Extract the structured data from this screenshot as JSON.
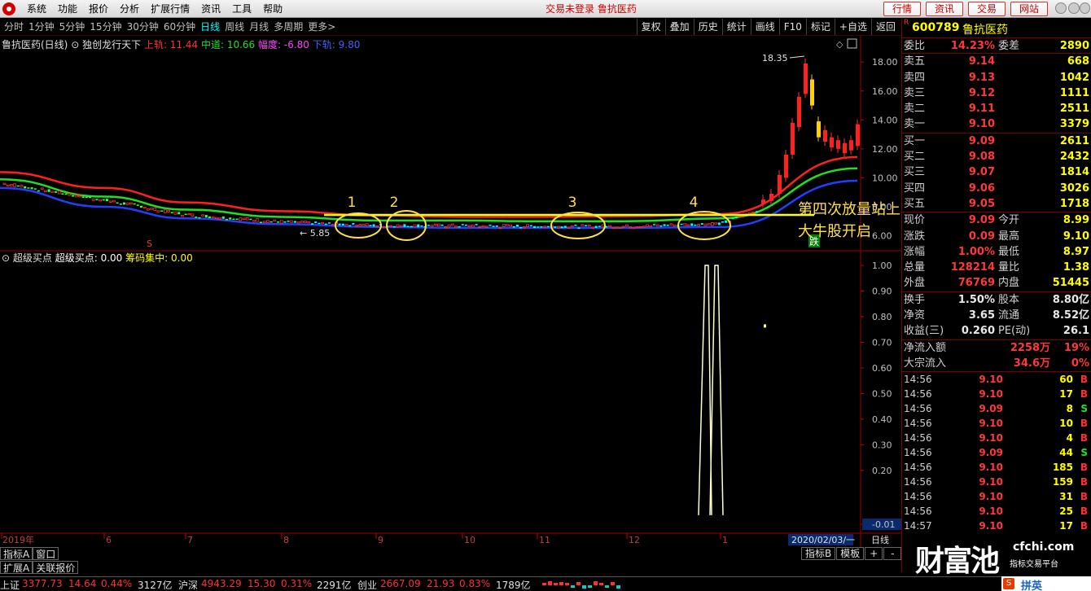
{
  "menu": {
    "items": [
      "系统",
      "功能",
      "报价",
      "分析",
      "扩展行情",
      "资讯",
      "工具",
      "帮助"
    ],
    "center_text": "交易未登录 鲁抗医药",
    "buttons": [
      "行情",
      "资讯",
      "交易",
      "网站"
    ]
  },
  "periods": {
    "items": [
      "分时",
      "1分钟",
      "5分钟",
      "15分钟",
      "30分钟",
      "60分钟",
      "日线",
      "周线",
      "月线",
      "多周期",
      "更多>"
    ],
    "active_index": 6,
    "right_items": [
      "复权",
      "叠加",
      "历史",
      "统计",
      "画线",
      "F10",
      "标记",
      "+自选",
      "返回"
    ]
  },
  "chart_header": {
    "stock": "鲁抗医药(日线)",
    "indicator": "独创龙行天下",
    "upper_label": "上轨: 11.44",
    "mid_label": "中道: 10.66",
    "range_label": "幅度: -6.80",
    "lower_label": "下轨: 9.80"
  },
  "sub_header": {
    "name": "超级买点",
    "value_label": "超级买点: 0.00",
    "chip_label": "筹码集中: 0.00"
  },
  "annotations": {
    "marks": [
      "1",
      "2",
      "3",
      "4"
    ],
    "text_line1": "第四次放量站上五线",
    "text_line2": "大牛股开启",
    "high_label": "18.35",
    "low_label": "5.85",
    "s_label": "S",
    "die_label": "跌"
  },
  "colors": {
    "up": "#ff3030",
    "down": "#00ffff",
    "upper_band": "#ff2020",
    "mid_band": "#20e020",
    "lower_band": "#2040ff",
    "annotation": "#ffe04a"
  },
  "chart_data": [
    {
      "type": "line",
      "title": "",
      "x": [
        "2019年",
        "6",
        "7",
        "8",
        "9",
        "10",
        "11",
        "12",
        "1",
        "2020/02/03/一"
      ],
      "series": [
        {
          "name": "上轨",
          "values": [
            10.4,
            9.3,
            8.3,
            7.7,
            7.4,
            7.3,
            7.3,
            7.35,
            7.5,
            11.44
          ]
        },
        {
          "name": "中道",
          "values": [
            9.9,
            8.7,
            7.8,
            7.3,
            7.05,
            7.05,
            7.0,
            7.0,
            7.2,
            10.66
          ]
        },
        {
          "name": "下轨",
          "values": [
            9.3,
            8.0,
            7.2,
            6.8,
            6.6,
            6.55,
            6.55,
            6.55,
            6.6,
            9.8
          ]
        }
      ],
      "yticks": [
        "18.00",
        "16.00",
        "14.00",
        "12.00",
        "10.00",
        "8.00",
        "6.00"
      ],
      "ylim": [
        5.3,
        18.8
      ],
      "annotations": [
        "18.35",
        "5.85"
      ]
    },
    {
      "type": "line",
      "title": "",
      "series": [
        {
          "name": "超级买点",
          "values": [
            0,
            0,
            0,
            0,
            0,
            0,
            0,
            0,
            1,
            0
          ]
        }
      ],
      "yticks": [
        "1.00",
        "0.90",
        "0.80",
        "0.70",
        "0.60",
        "0.50",
        "0.40",
        "0.30",
        "0.20",
        "-0.01"
      ],
      "ylim": [
        -0.01,
        1.0
      ]
    }
  ],
  "axis": {
    "y1": [
      "18.00",
      "16.00",
      "14.00",
      "12.00",
      "10.00",
      "8.00",
      "6.00"
    ],
    "y2": [
      "1.00",
      "0.90",
      "0.80",
      "0.70",
      "0.60",
      "0.50",
      "0.40",
      "0.30",
      "0.20",
      "-0.01"
    ],
    "x": [
      "2019年",
      "6",
      "7",
      "8",
      "9",
      "10",
      "11",
      "12",
      "1"
    ],
    "date_badge": "2020/02/03/一",
    "right_label": "日线"
  },
  "quote": {
    "code": "600789",
    "name": "鲁抗医药",
    "r_mark": "R",
    "weibi_label": "委比",
    "weibi": "14.23%",
    "weicha_label": "委差",
    "weicha": "2890",
    "asks": [
      {
        "label": "卖五",
        "price": "9.14",
        "vol": "668"
      },
      {
        "label": "卖四",
        "price": "9.13",
        "vol": "1042"
      },
      {
        "label": "卖三",
        "price": "9.12",
        "vol": "1111"
      },
      {
        "label": "卖二",
        "price": "9.11",
        "vol": "2511"
      },
      {
        "label": "卖一",
        "price": "9.10",
        "vol": "3379"
      }
    ],
    "bids": [
      {
        "label": "买一",
        "price": "9.09",
        "vol": "2611"
      },
      {
        "label": "买二",
        "price": "9.08",
        "vol": "2432"
      },
      {
        "label": "买三",
        "price": "9.07",
        "vol": "1814"
      },
      {
        "label": "买四",
        "price": "9.06",
        "vol": "3026"
      },
      {
        "label": "买五",
        "price": "9.05",
        "vol": "1718"
      }
    ],
    "stats": [
      {
        "l": "现价",
        "m": "9.09",
        "l2": "今开",
        "v": "8.99"
      },
      {
        "l": "涨跌",
        "m": "0.09",
        "l2": "最高",
        "v": "9.10"
      },
      {
        "l": "涨幅",
        "m": "1.00%",
        "l2": "最低",
        "v": "8.97"
      },
      {
        "l": "总量",
        "m": "128214",
        "l2": "量比",
        "v": "1.38"
      },
      {
        "l": "外盘",
        "m": "76769",
        "l2": "内盘",
        "v": "51445"
      }
    ],
    "stats2": [
      {
        "l": "换手",
        "m": "1.50%",
        "l2": "股本",
        "v": "8.80亿"
      },
      {
        "l": "净资",
        "m": "3.65",
        "l2": "流通",
        "v": "8.52亿"
      },
      {
        "l": "收益(三)",
        "m": "0.260",
        "l2": "PE(动)",
        "v": "26.1"
      }
    ],
    "flows": [
      {
        "l": "净流入额",
        "m": "2258万",
        "v": "19%"
      },
      {
        "l": "大宗流入",
        "m": "34.6万",
        "v": "0%"
      }
    ],
    "ticks": [
      {
        "t": "14:56",
        "p": "9.10",
        "q": "60",
        "s": "B"
      },
      {
        "t": "14:56",
        "p": "9.10",
        "q": "17",
        "s": "B"
      },
      {
        "t": "14:56",
        "p": "9.09",
        "q": "8",
        "s": "S"
      },
      {
        "t": "14:56",
        "p": "9.10",
        "q": "10",
        "s": "B"
      },
      {
        "t": "14:56",
        "p": "9.10",
        "q": "4",
        "s": "B"
      },
      {
        "t": "14:56",
        "p": "9.09",
        "q": "44",
        "s": "S"
      },
      {
        "t": "14:56",
        "p": "9.10",
        "q": "185",
        "s": "B"
      },
      {
        "t": "14:56",
        "p": "9.10",
        "q": "159",
        "s": "B"
      },
      {
        "t": "14:56",
        "p": "9.10",
        "q": "31",
        "s": "B"
      },
      {
        "t": "14:56",
        "p": "9.10",
        "q": "25",
        "s": "B"
      },
      {
        "t": "14:57",
        "p": "9.10",
        "q": "17",
        "s": "B"
      }
    ]
  },
  "bottom_tabs": {
    "row1": [
      "指标A",
      "窗口"
    ],
    "row2": [
      "扩展A",
      "关联报价"
    ],
    "right": [
      "指标B",
      "模板",
      "+",
      "-"
    ]
  },
  "status": {
    "sh_label": "上证",
    "sh_value": "3377.73",
    "sh_chg": "14.64",
    "sh_pct": "0.44%",
    "sh_amt": "3127亿",
    "hs_label": "沪深",
    "hs_value": "4943.29",
    "hs_chg": "15.30",
    "hs_pct": "0.31%",
    "hs_amt": "2291亿",
    "cy_label": "创业",
    "cy_value": "2667.09",
    "cy_chg": "21.93",
    "cy_pct": "0.83%",
    "cy_amt": "1789亿"
  },
  "watermark": {
    "big": "财富池",
    "url": "cfchi.com",
    "sub": "指标交易平台",
    "pinying": "拼英"
  }
}
